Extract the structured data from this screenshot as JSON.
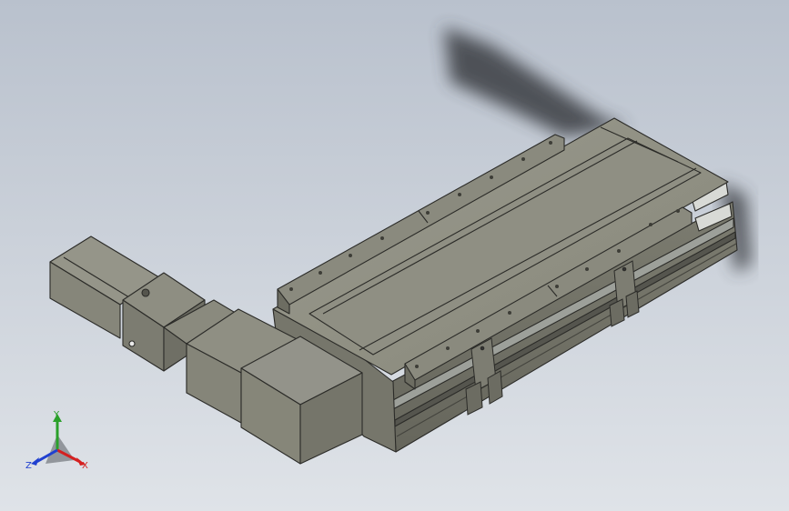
{
  "viewport": {
    "background_top": "#b9c1cd",
    "background_bottom": "#dfe3e8"
  },
  "model": {
    "body_color": "#8e8e82",
    "edge_color": "#2b2b28"
  },
  "triad": {
    "x_label": "X",
    "y_label": "Y",
    "z_label": "Z",
    "x_color": "#d42020",
    "y_color": "#2aa02a",
    "z_color": "#2040d0"
  }
}
